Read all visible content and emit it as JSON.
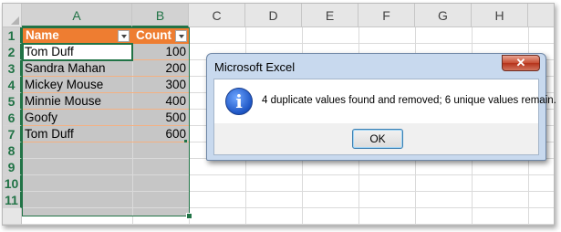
{
  "columns": [
    "A",
    "B",
    "C",
    "D",
    "E",
    "F",
    "G",
    "H"
  ],
  "rows": [
    "1",
    "2",
    "3",
    "4",
    "5",
    "6",
    "7",
    "8",
    "9",
    "10",
    "11"
  ],
  "table": {
    "headers": [
      "Name",
      "Count"
    ],
    "data": [
      [
        "Tom Duff",
        "100"
      ],
      [
        "Sandra Mahan",
        "200"
      ],
      [
        "Mickey Mouse",
        "300"
      ],
      [
        "Minnie Mouse",
        "400"
      ],
      [
        "Goofy",
        "500"
      ],
      [
        "Tom Duff",
        "600"
      ]
    ]
  },
  "dialog": {
    "title": "Microsoft Excel",
    "close_label": "✕",
    "message": "4 duplicate values found and removed; 6 unique values remain.",
    "ok_label": "OK",
    "icon": "info-icon"
  },
  "colors": {
    "header_fill": "#ee7d31",
    "selection_border": "#217346",
    "selection_fill": "#c6c6c6"
  }
}
